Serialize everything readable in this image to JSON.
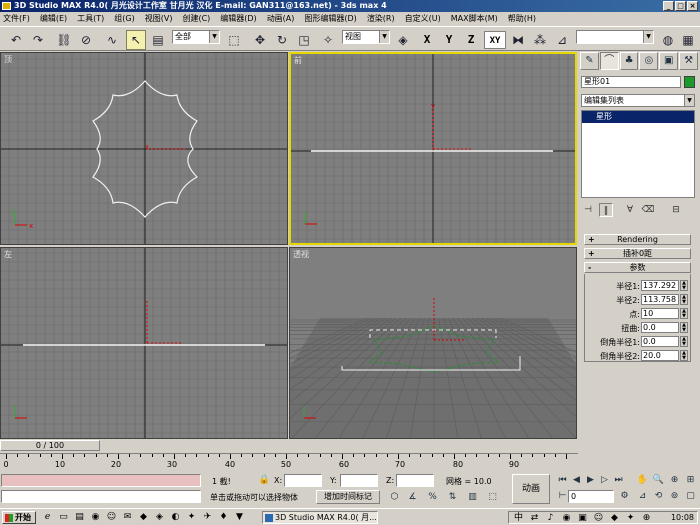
{
  "window": {
    "title": "3D Studio MAX R4.0( 月光设计工作室 甘月光 汉化 E-mail: GAN311@163.net) - 3ds max 4"
  },
  "menu": [
    "文件(F)",
    "编辑(E)",
    "工具(T)",
    "组(G)",
    "视图(V)",
    "创建(C)",
    "编辑器(D)",
    "动画(A)",
    "图形编辑器(D)",
    "渲染(R)",
    "自定义(U)",
    "MAX脚本(M)",
    "帮助(H)"
  ],
  "toolbar": {
    "selection_filter": "全部",
    "reference_coord": "视图",
    "axis_buttons": [
      "X",
      "Y",
      "Z",
      "XY"
    ],
    "active_axis": "XY",
    "named_selection": ""
  },
  "viewports": {
    "top": "顶",
    "front": "前",
    "left": "左",
    "perspective": "透视",
    "active": "front"
  },
  "command_panel": {
    "object_name": "星形01",
    "object_color": "#1a9a2a",
    "modifier_list": "编辑集列表",
    "stack_items": [
      "星形"
    ],
    "rollouts": [
      "Rendering",
      "插补0距",
      "参数"
    ],
    "params": [
      {
        "label": "半径1:",
        "value": "137.292"
      },
      {
        "label": "半径2:",
        "value": "113.758"
      },
      {
        "label": "点:",
        "value": "10"
      },
      {
        "label": "扭曲:",
        "value": "0.0"
      },
      {
        "label": "倒角半径1:",
        "value": "0.0"
      },
      {
        "label": "倒角半径2:",
        "value": "20.0"
      }
    ]
  },
  "timeline": {
    "slider": "0 / 100",
    "ticks": [
      "0",
      "10",
      "20",
      "30",
      "40",
      "50",
      "60",
      "70",
      "80",
      "90"
    ]
  },
  "status": {
    "selected": "1 截!",
    "x_label": "X:",
    "y_label": "Y:",
    "z_label": "Z:",
    "x_value": "",
    "y_value": "",
    "z_value": "",
    "grid_label": "网格 = 10.0",
    "prompt": "单击或拖动可以选择物体",
    "add_time_tag": "增加时间标记",
    "animate": "动画",
    "frame": "0",
    "maxscript": ""
  },
  "taskbar": {
    "start": "开始",
    "task": "3D Studio MAX R4.0( 月...",
    "clock": "10:08"
  }
}
